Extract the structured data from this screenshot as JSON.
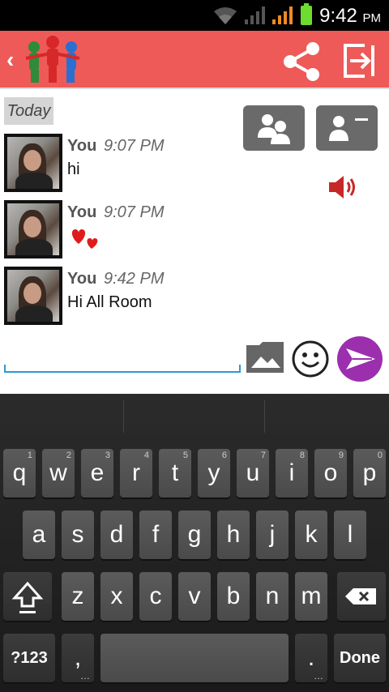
{
  "status_bar": {
    "time": "9:42",
    "ampm": "PM"
  },
  "colors": {
    "app_bar": "#ee5a58",
    "send_button": "#9b2fae",
    "speaker": "#c62828",
    "input_underline": "#2b9bd0"
  },
  "app_bar": {
    "back_icon": "chevron-left-icon",
    "logo": "group-logo",
    "actions": [
      "share-icon",
      "exit-icon"
    ]
  },
  "chat": {
    "date_label": "Today",
    "messages": [
      {
        "sender": "You",
        "time": "9:07 PM",
        "text": "hi"
      },
      {
        "sender": "You",
        "time": "9:07 PM",
        "text": "",
        "sticker": "hearts"
      },
      {
        "sender": "You",
        "time": "9:42 PM",
        "text": "Hi All Room"
      }
    ],
    "side_buttons": [
      "group-icon",
      "contact-card-icon",
      "speaker-icon"
    ]
  },
  "composer": {
    "value": "",
    "placeholder": "",
    "buttons": [
      "gallery-icon",
      "emoji-icon",
      "send-icon"
    ]
  },
  "keyboard": {
    "row1": [
      {
        "key": "q",
        "hint": "1"
      },
      {
        "key": "w",
        "hint": "2"
      },
      {
        "key": "e",
        "hint": "3"
      },
      {
        "key": "r",
        "hint": "4"
      },
      {
        "key": "t",
        "hint": "5"
      },
      {
        "key": "y",
        "hint": "6"
      },
      {
        "key": "u",
        "hint": "7"
      },
      {
        "key": "i",
        "hint": "8"
      },
      {
        "key": "o",
        "hint": "9"
      },
      {
        "key": "p",
        "hint": "0"
      }
    ],
    "row2": [
      "a",
      "s",
      "d",
      "f",
      "g",
      "h",
      "j",
      "k",
      "l"
    ],
    "row3": [
      "z",
      "x",
      "c",
      "v",
      "b",
      "n",
      "m"
    ],
    "symbols": "?123",
    "comma": ",",
    "period": ".",
    "done": "Done"
  }
}
